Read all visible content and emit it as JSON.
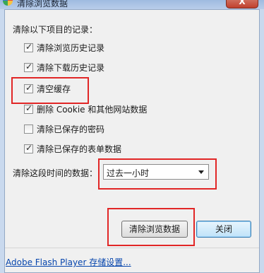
{
  "window": {
    "title": "清除浏览数据",
    "close_glyph": "X"
  },
  "section_label": "清除以下项目的记录：",
  "options": [
    {
      "label": "清除浏览历史记录",
      "checked": true
    },
    {
      "label": "清除下载历史记录",
      "checked": true
    },
    {
      "label": "清空缓存",
      "checked": true
    },
    {
      "label": "删除 Cookie 和其他网站数据",
      "checked": true
    },
    {
      "label": "清除已保存的密码",
      "checked": false
    },
    {
      "label": "清除已保存的表单数据",
      "checked": true
    }
  ],
  "time_range": {
    "label": "清除这段时间的数据：",
    "selected": "过去一小时"
  },
  "buttons": {
    "clear_label": "清除浏览数据",
    "close_label": "关闭"
  },
  "footer": {
    "flash_link": "Adobe Flash Player 存储设置..."
  },
  "colors": {
    "annotation": "#e12626",
    "link": "#0645ad"
  }
}
